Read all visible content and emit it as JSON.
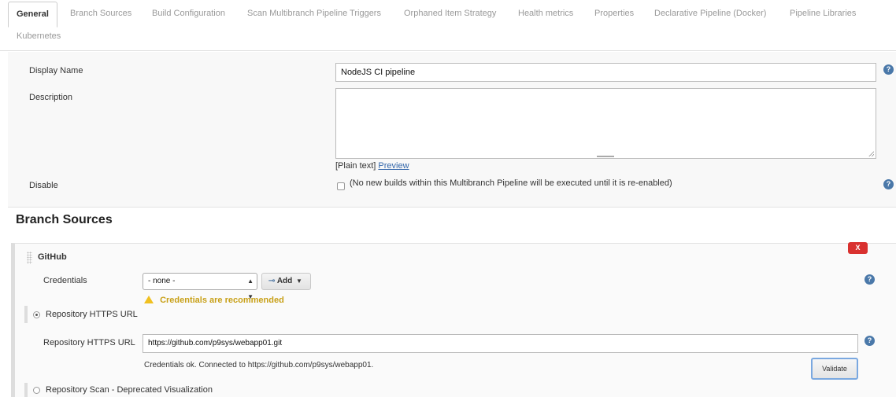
{
  "tabs": [
    {
      "label": "General",
      "active": true
    },
    {
      "label": "Branch Sources"
    },
    {
      "label": "Build Configuration"
    },
    {
      "label": "Scan Multibranch Pipeline Triggers"
    },
    {
      "label": "Orphaned Item Strategy"
    },
    {
      "label": "Health metrics"
    },
    {
      "label": "Properties"
    },
    {
      "label": "Declarative Pipeline (Docker)"
    },
    {
      "label": "Pipeline Libraries"
    },
    {
      "label": "Kubernetes"
    }
  ],
  "general": {
    "display_name_label": "Display Name",
    "display_name_value": "NodeJS CI pipeline",
    "description_label": "Description",
    "description_value": "",
    "plain_text": "[Plain text]",
    "preview_link": "Preview",
    "disable_label": "Disable",
    "disable_text": "(No new builds within this Multibranch Pipeline will be executed until it is re-enabled)",
    "disable_checked": false
  },
  "branch_sources": {
    "title": "Branch Sources",
    "source_title": "GitHub",
    "delete_label": "X",
    "credentials_label": "Credentials",
    "credentials_selected": "- none -",
    "add_label": "Add",
    "credentials_warning": "Credentials are recommended",
    "repo_url_radio_label": "Repository HTTPS URL",
    "repo_url_field_label": "Repository HTTPS URL",
    "repo_url_value": "https://github.com/p9sys/webapp01.git",
    "validation_message": "Credentials ok. Connected to https://github.com/p9sys/webapp01.",
    "validate_label": "Validate",
    "repo_scan_radio_label": "Repository Scan - Deprecated Visualization"
  },
  "help_glyph": "?",
  "icons": {
    "help": "question-circle-icon",
    "warning": "warning-triangle-icon",
    "key": "key-icon"
  },
  "colors": {
    "help_icon": "#4a78a9",
    "delete_button": "#d9312f",
    "warning_text": "#c8a017",
    "link": "#3366aa"
  }
}
